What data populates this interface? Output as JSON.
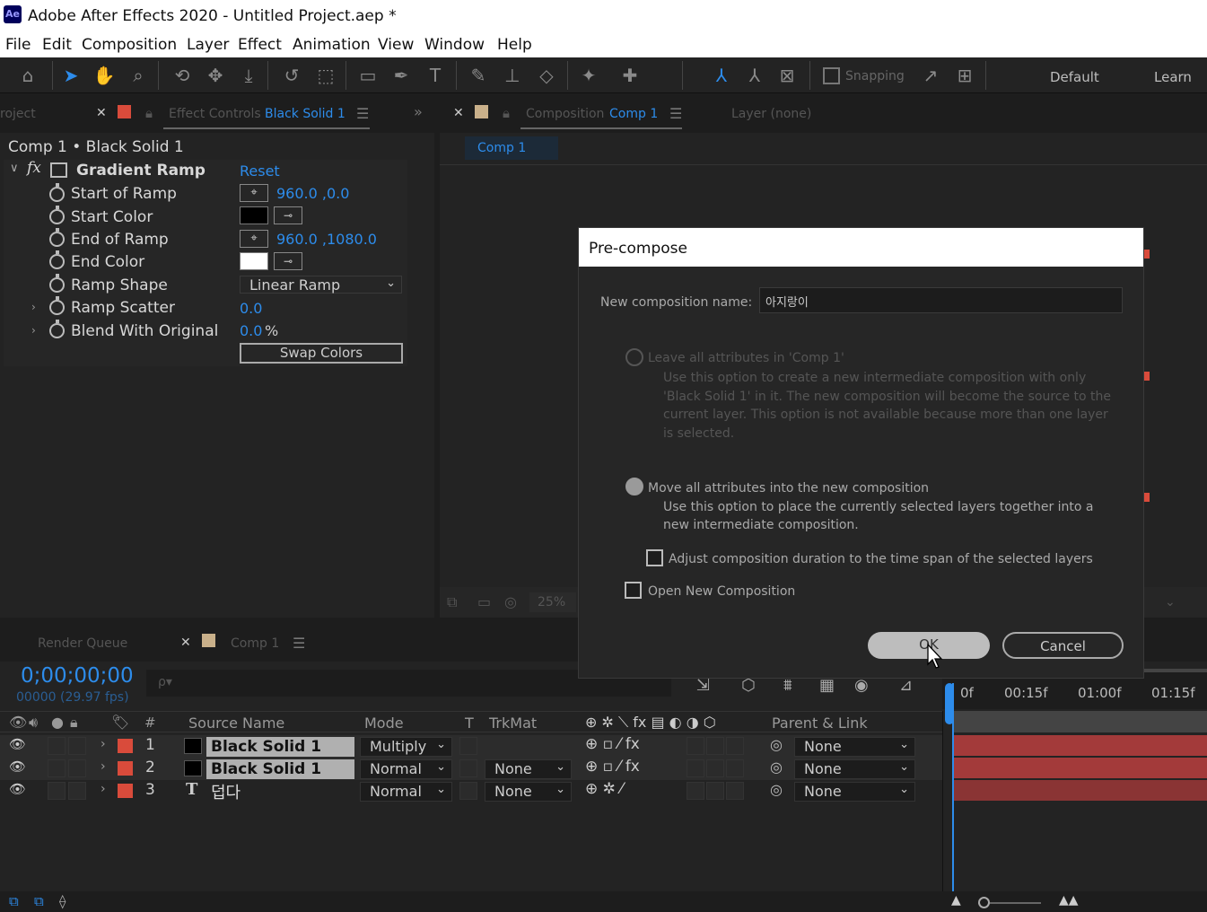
{
  "window": {
    "logo": "Ae",
    "title": "Adobe After Effects 2020 - Untitled Project.aep *"
  },
  "menu": [
    "File",
    "Edit",
    "Composition",
    "Layer",
    "Effect",
    "Animation",
    "View",
    "Window",
    "Help"
  ],
  "toolbar": {
    "snapping_label": "Snapping",
    "workspace_default": "Default",
    "workspace_learn": "Learn"
  },
  "left_panel": {
    "project_tab": "roject",
    "effect_controls_tab": "Effect Controls",
    "effect_controls_target": "Black Solid 1",
    "breadcrumb": "Comp 1 • Black Solid 1",
    "effect_name": "Gradient Ramp",
    "reset_label": "Reset",
    "props": [
      {
        "label": "Start of Ramp",
        "value": "960.0 ,0.0"
      },
      {
        "label": "Start Color",
        "value": ""
      },
      {
        "label": "End of Ramp",
        "value": "960.0 ,1080.0"
      },
      {
        "label": "End Color",
        "value": ""
      },
      {
        "label": "Ramp Shape",
        "value": "Linear Ramp"
      },
      {
        "label": "Ramp Scatter",
        "value": "0.0"
      },
      {
        "label": "Blend With Original",
        "value": "0.0",
        "unit": "%"
      }
    ],
    "swap_colors_label": "Swap Colors",
    "start_color": "#000000",
    "end_color": "#ffffff"
  },
  "comp_panel": {
    "tab_label": "Composition",
    "tab_target": "Comp 1",
    "layer_tab": "Layer (none)",
    "subtab": "Comp 1",
    "zoom": "25%"
  },
  "dialog": {
    "title": "Pre-compose",
    "name_label": "New composition name:",
    "name_value": "아지랑이",
    "option1_title": "Leave all attributes in 'Comp 1'",
    "option1_desc": "Use this option to create a new intermediate composition with only 'Black Solid 1' in it. The new composition will become the source to the current layer. This option is not available because more than one layer is selected.",
    "option2_title": "Move all attributes into the new composition",
    "option2_desc": "Use this option to place the currently selected layers together into a new intermediate composition.",
    "adjust_duration_label": "Adjust composition duration to the time span of the selected layers",
    "open_new_label": "Open New Composition",
    "ok_label": "OK",
    "cancel_label": "Cancel"
  },
  "timeline": {
    "render_queue_tab": "Render Queue",
    "comp_tab": "Comp 1",
    "timecode": "0;00;00;00",
    "frame_info": "00000 (29.97 fps)",
    "search_placeholder": "ρ▾",
    "headers": {
      "num": "#",
      "source_name": "Source Name",
      "mode": "Mode",
      "t": "T",
      "trkmat": "TrkMat",
      "parent_link": "Parent & Link"
    },
    "ruler": [
      "0f",
      "00:15f",
      "01:00f",
      "01:15f"
    ],
    "layers": [
      {
        "num": "1",
        "name": "Black Solid 1",
        "mode": "Multiply",
        "trkmat": "",
        "parent": "None",
        "type": "solid"
      },
      {
        "num": "2",
        "name": "Black Solid 1",
        "mode": "Normal",
        "trkmat": "None",
        "parent": "None",
        "type": "solid"
      },
      {
        "num": "3",
        "name": "덥다",
        "mode": "Normal",
        "trkmat": "None",
        "parent": "None",
        "type": "text",
        "type_glyph": "T"
      }
    ]
  }
}
